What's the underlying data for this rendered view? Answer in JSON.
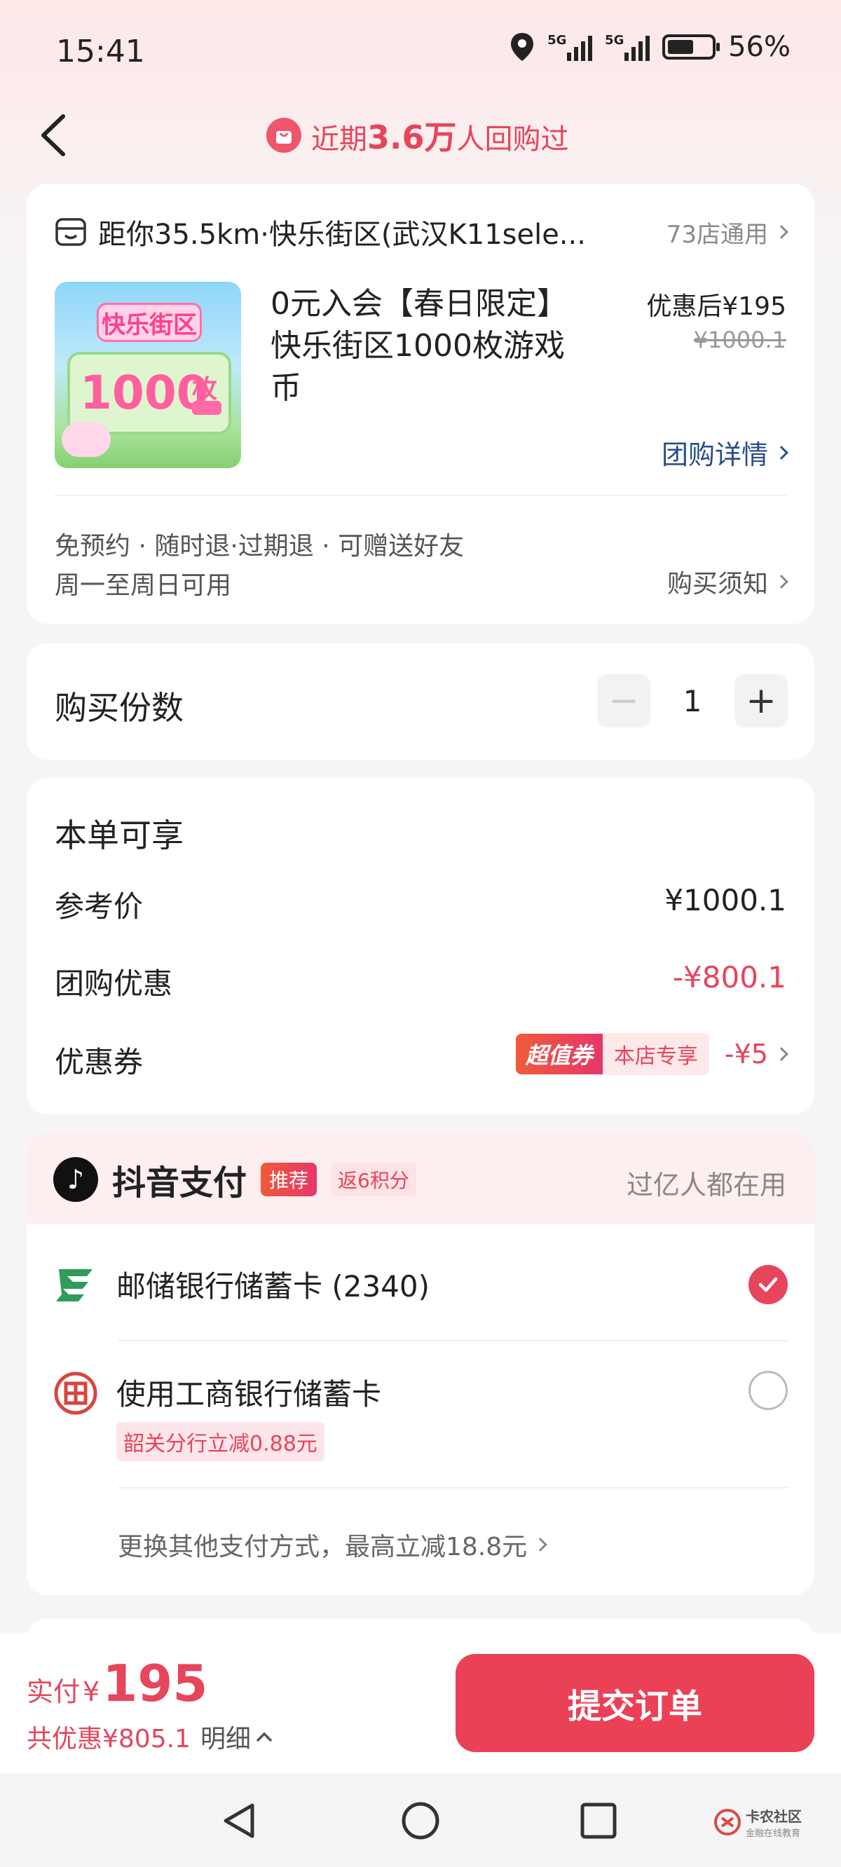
{
  "status_bar": {
    "time": "15:41",
    "net1": "5G",
    "net2": "5G",
    "battery": "56%"
  },
  "header": {
    "title_prefix": "近期",
    "title_num": "3.6万",
    "title_suffix": "人回购过"
  },
  "product": {
    "store_line": "距你35.5km·快乐街区(武汉K11sele...",
    "store_count": "73店通用",
    "name_line1": "0元入会【春日限定】",
    "name_line2": "快乐街区1000枚游戏币",
    "price_label": "优惠后¥195",
    "orig_price": "¥1000.1",
    "detail_link": "团购详情",
    "features": "免预约 · 随时退·过期退 · 可赠送好友",
    "availability": "周一至周日可用",
    "notice_link": "购买须知",
    "thumb": {
      "brand": "快乐街区",
      "amount": "1000",
      "unit": "枚"
    }
  },
  "quantity": {
    "label": "购买份数",
    "minus": "−",
    "value": "1",
    "plus": "+"
  },
  "benefits": {
    "title": "本单可享",
    "ref_label": "参考价",
    "ref_value": "¥1000.1",
    "group_label": "团购优惠",
    "group_value": "-¥800.1",
    "coupon_label": "优惠券",
    "coupon_hot": "超值券",
    "coupon_store": "本店专享",
    "coupon_value": "-¥5"
  },
  "payment": {
    "title": "抖音支付",
    "badge_rec": "推荐",
    "badge_points": "返6积分",
    "tagline": "过亿人都在用",
    "option1": "邮储银行储蓄卡 (2340)",
    "option2": "使用工商银行储蓄卡",
    "option2_promo": "韶关分行立减0.88元",
    "more": "更换其他支付方式，最高立减18.8元"
  },
  "footer": {
    "pay_label": "实付",
    "currency": "¥",
    "pay_amount": "195",
    "saved": "共优惠¥805.1",
    "detail": "明细",
    "submit": "提交订单"
  },
  "watermark": {
    "name": "卡农社区",
    "sub": "金融在线教育"
  },
  "colors": {
    "accent": "#ea4157",
    "link": "#2b4e86"
  }
}
